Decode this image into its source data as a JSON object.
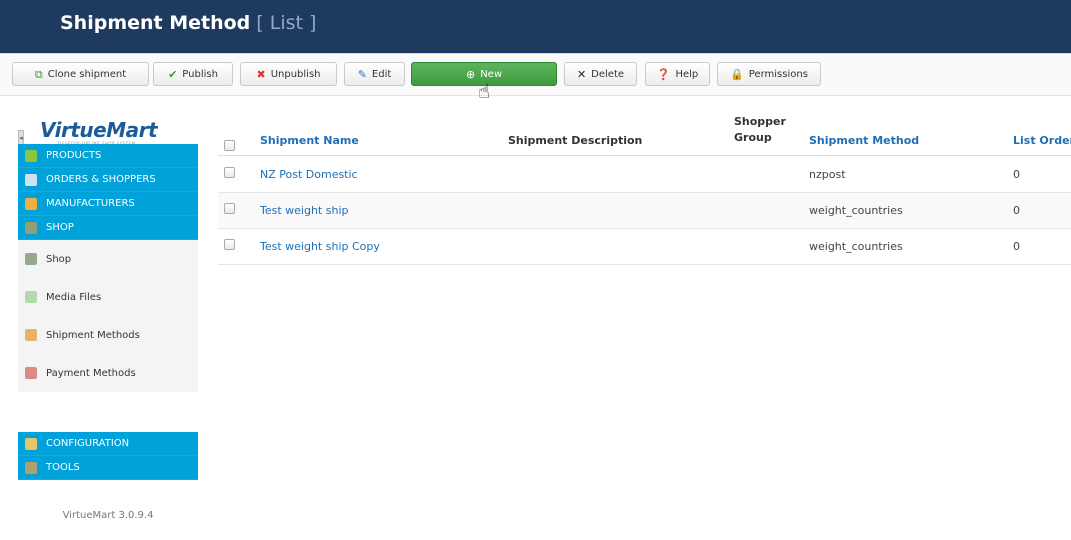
{
  "header": {
    "title": "Shipment Method",
    "subtitle": "[ List ]"
  },
  "toolbar": {
    "clone": "Clone shipment",
    "publish": "Publish",
    "unpublish": "Unpublish",
    "edit": "Edit",
    "new": "New",
    "delete": "Delete",
    "help": "Help",
    "permissions": "Permissions"
  },
  "sidebar": {
    "logo": "VirtueMart",
    "logo_tagline": "DESKTOP-ONLINE SHOP SYSTEM",
    "menu": [
      {
        "label": "PRODUCTS",
        "icon": "products-icon"
      },
      {
        "label": "ORDERS & SHOPPERS",
        "icon": "orders-icon"
      },
      {
        "label": "MANUFACTURERS",
        "icon": "wrench-icon"
      },
      {
        "label": "SHOP",
        "icon": "shop-icon"
      }
    ],
    "shop_items": [
      {
        "label": "Shop",
        "icon": "shop-icon"
      },
      {
        "label": "Media Files",
        "icon": "media-icon"
      },
      {
        "label": "Shipment Methods",
        "icon": "truck-icon"
      },
      {
        "label": "Payment Methods",
        "icon": "payment-icon"
      }
    ],
    "menu_bottom": [
      {
        "label": "CONFIGURATION",
        "icon": "config-icon"
      },
      {
        "label": "TOOLS",
        "icon": "tools-icon"
      }
    ],
    "version": "VirtueMart 3.0.9.4"
  },
  "table": {
    "columns": {
      "name": "Shipment Name",
      "description": "Shipment Description",
      "group": "Shopper Group",
      "method": "Shipment Method",
      "order": "List Order"
    },
    "rows": [
      {
        "name": "NZ Post Domestic",
        "description": "",
        "group": "",
        "method": "nzpost",
        "order": "0"
      },
      {
        "name": "Test weight ship",
        "description": "",
        "group": "",
        "method": "weight_countries",
        "order": "0"
      },
      {
        "name": "Test weight ship Copy",
        "description": "",
        "group": "",
        "method": "weight_countries",
        "order": "0"
      }
    ]
  },
  "colors": {
    "header_bg": "#1e3a5f",
    "nav_blue": "#00a2d9",
    "new_green": "#4caf4c",
    "link": "#1f6fb5"
  }
}
